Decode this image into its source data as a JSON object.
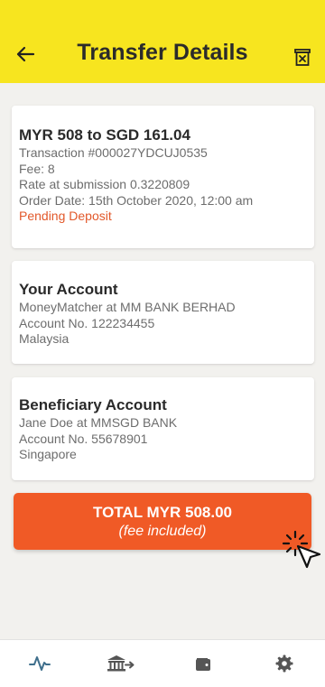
{
  "header": {
    "title": "Transfer Details",
    "back_icon": "arrow-left-icon",
    "delete_icon": "trash-box-icon",
    "background": "#f7e51f"
  },
  "summary": {
    "title": "MYR 508 to SGD 161.04",
    "transaction": "Transaction #000027YDCUJ0535",
    "fee": "Fee: 8",
    "rate": "Rate at submission 0.3220809",
    "order_date": "Order Date: 15th October 2020, 12:00 am",
    "status": "Pending Deposit",
    "status_color": "#e2582a"
  },
  "your_account": {
    "title": "Your Account",
    "bank": "MoneyMatcher at MM BANK BERHAD",
    "account_no": "Account No. 122234455",
    "country": "Malaysia"
  },
  "beneficiary": {
    "title": "Beneficiary Account",
    "bank": "Jane Doe at MMSGD BANK",
    "account_no": "Account No. 55678901",
    "country": "Singapore"
  },
  "total_button": {
    "label": "TOTAL MYR 508.00",
    "sublabel": "(fee included)",
    "color": "#f05a26"
  },
  "bottom_nav": {
    "items": [
      {
        "icon": "activity-icon",
        "active": true
      },
      {
        "icon": "bank-transfer-icon",
        "active": false
      },
      {
        "icon": "wallet-icon",
        "active": false
      },
      {
        "icon": "gear-icon",
        "active": false
      }
    ],
    "active_color": "#3f6f8c",
    "inactive_color": "#555555"
  }
}
